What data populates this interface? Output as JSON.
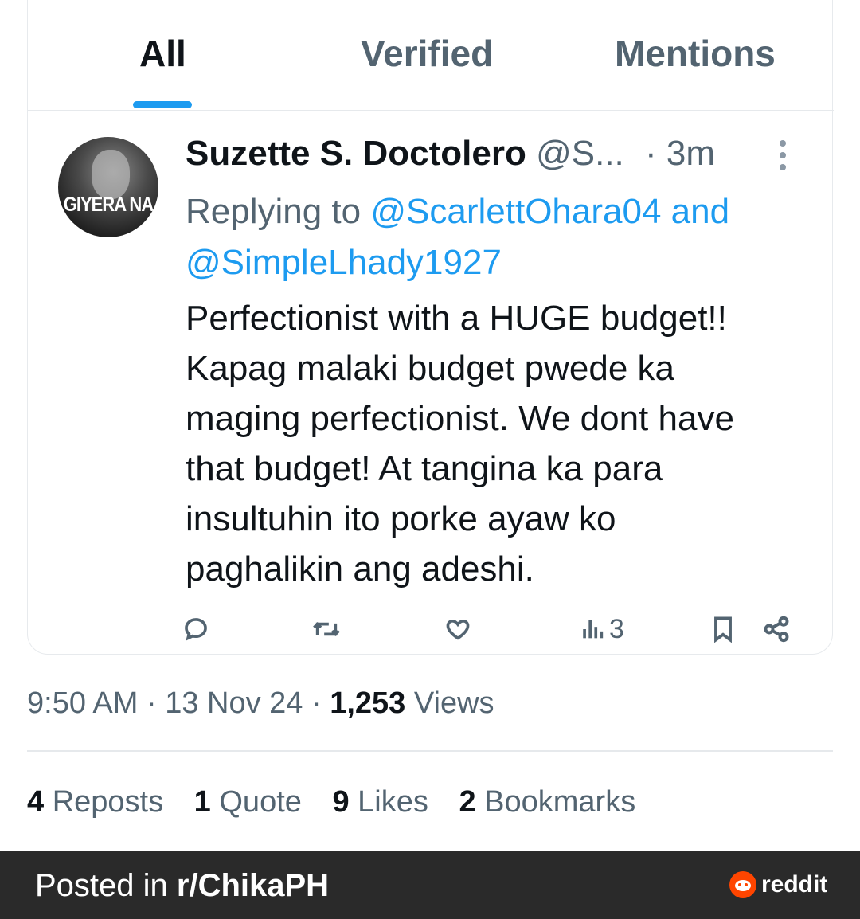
{
  "tabs": [
    {
      "label": "All",
      "active": true
    },
    {
      "label": "Verified",
      "active": false
    },
    {
      "label": "Mentions",
      "active": false
    }
  ],
  "tweet": {
    "avatar_text": "GIYERA NA",
    "author_name": "Suzette S. Doctolero",
    "author_handle": "@S...",
    "time": "· 3m",
    "reply_prefix": "Replying to",
    "reply_mention_1": "@ScarlettOhara04",
    "reply_and": "and",
    "reply_mention_2": "@SimpleLhady1927",
    "text": "Perfectionist with a HUGE  budget!!\nKapag malaki budget pwede ka\nmaging perfectionist.  We dont have\nthat budget!  At tangina ka para\ninsultuhin ito porke ayaw ko\npaghalikin ang adeshi.",
    "views_count": "3"
  },
  "meta": {
    "time": "9:50 AM",
    "date": "13 Nov 24",
    "views_number": "1,253",
    "views_label": "Views",
    "separator": "·"
  },
  "stats": [
    {
      "number": "4",
      "label": "Reposts"
    },
    {
      "number": "1",
      "label": "Quote"
    },
    {
      "number": "9",
      "label": "Likes"
    },
    {
      "number": "2",
      "label": "Bookmarks"
    }
  ],
  "footer": {
    "posted_in": "Posted in ",
    "subreddit": "r/ChikaPH",
    "brand": "reddit"
  },
  "colors": {
    "accent": "#1d9bf0",
    "muted": "#536471",
    "footer_bg": "#2a2a2a",
    "reddit_orange": "#ff4500"
  }
}
